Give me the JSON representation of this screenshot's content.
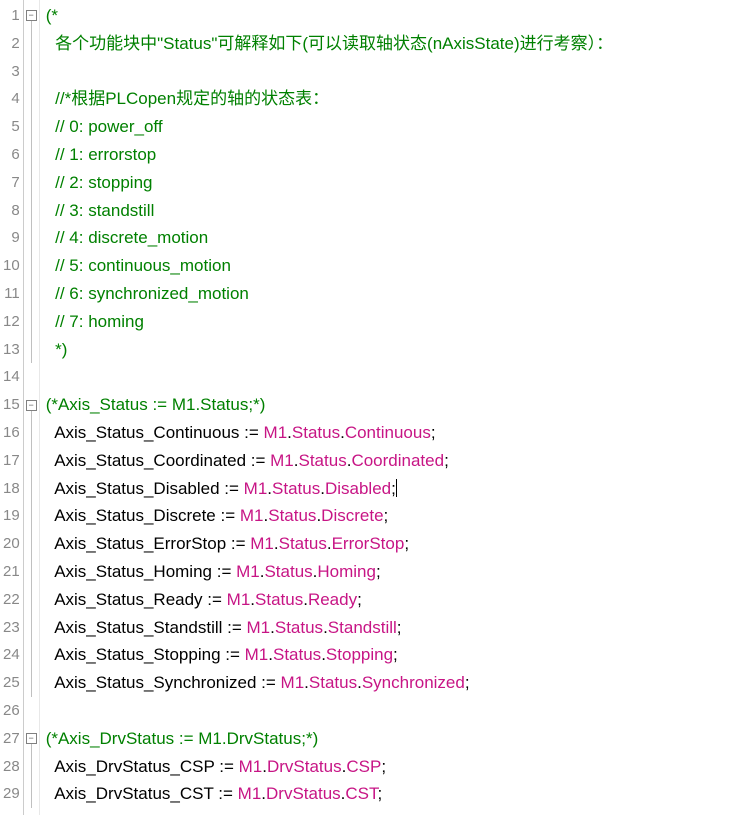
{
  "lines": [
    {
      "num": 1,
      "fold": "box",
      "spans": [
        {
          "cls": "c-comment",
          "t": "(*"
        }
      ]
    },
    {
      "num": 2,
      "fold": "line",
      "spans": [
        {
          "cls": "c-comment",
          "t": "  各个功能块中\"Status\"可解释如下(可以读取轴状态(nAxisState)进行考察）："
        }
      ]
    },
    {
      "num": 3,
      "fold": "line",
      "spans": [
        {
          "cls": "c-comment",
          "t": ""
        }
      ]
    },
    {
      "num": 4,
      "fold": "line",
      "spans": [
        {
          "cls": "c-comment",
          "t": "  //*根据PLCopen规定的轴的状态表："
        }
      ]
    },
    {
      "num": 5,
      "fold": "line",
      "spans": [
        {
          "cls": "c-comment",
          "t": "  // 0: power_off"
        }
      ]
    },
    {
      "num": 6,
      "fold": "line",
      "spans": [
        {
          "cls": "c-comment",
          "t": "  // 1: errorstop"
        }
      ]
    },
    {
      "num": 7,
      "fold": "line",
      "spans": [
        {
          "cls": "c-comment",
          "t": "  // 2: stopping"
        }
      ]
    },
    {
      "num": 8,
      "fold": "line",
      "spans": [
        {
          "cls": "c-comment",
          "t": "  // 3: standstill"
        }
      ]
    },
    {
      "num": 9,
      "fold": "line",
      "spans": [
        {
          "cls": "c-comment",
          "t": "  // 4: discrete_motion"
        }
      ]
    },
    {
      "num": 10,
      "fold": "line",
      "spans": [
        {
          "cls": "c-comment",
          "t": "  // 5: continuous_motion"
        }
      ]
    },
    {
      "num": 11,
      "fold": "line",
      "spans": [
        {
          "cls": "c-comment",
          "t": "  // 6: synchronized_motion"
        }
      ]
    },
    {
      "num": 12,
      "fold": "line",
      "spans": [
        {
          "cls": "c-comment",
          "t": "  // 7: homing"
        }
      ]
    },
    {
      "num": 13,
      "fold": "line",
      "spans": [
        {
          "cls": "c-comment",
          "t": "  *)"
        }
      ]
    },
    {
      "num": 14,
      "fold": "none",
      "spans": [
        {
          "cls": "",
          "t": ""
        }
      ]
    },
    {
      "num": 15,
      "fold": "box",
      "spans": [
        {
          "cls": "c-comment",
          "t": "(*Axis_Status := M1.Status;*)"
        }
      ]
    },
    {
      "num": 16,
      "fold": "line",
      "spans": [
        {
          "cls": "c-var",
          "t": "  Axis_Status_Continuous "
        },
        {
          "cls": "c-op",
          "t": ":= "
        },
        {
          "cls": "c-member",
          "t": "M1"
        },
        {
          "cls": "c-op",
          "t": "."
        },
        {
          "cls": "c-member",
          "t": "Status"
        },
        {
          "cls": "c-op",
          "t": "."
        },
        {
          "cls": "c-member",
          "t": "Continuous"
        },
        {
          "cls": "c-op",
          "t": ";"
        }
      ]
    },
    {
      "num": 17,
      "fold": "line",
      "spans": [
        {
          "cls": "c-var",
          "t": "  Axis_Status_Coordinated "
        },
        {
          "cls": "c-op",
          "t": ":= "
        },
        {
          "cls": "c-member",
          "t": "M1"
        },
        {
          "cls": "c-op",
          "t": "."
        },
        {
          "cls": "c-member",
          "t": "Status"
        },
        {
          "cls": "c-op",
          "t": "."
        },
        {
          "cls": "c-member",
          "t": "Coordinated"
        },
        {
          "cls": "c-op",
          "t": ";"
        }
      ]
    },
    {
      "num": 18,
      "fold": "line",
      "cursor": true,
      "spans": [
        {
          "cls": "c-var",
          "t": "  Axis_Status_Disabled "
        },
        {
          "cls": "c-op",
          "t": ":= "
        },
        {
          "cls": "c-member",
          "t": "M1"
        },
        {
          "cls": "c-op",
          "t": "."
        },
        {
          "cls": "c-member",
          "t": "Status"
        },
        {
          "cls": "c-op",
          "t": "."
        },
        {
          "cls": "c-member",
          "t": "Disabled"
        },
        {
          "cls": "c-op",
          "t": ";"
        }
      ]
    },
    {
      "num": 19,
      "fold": "line",
      "spans": [
        {
          "cls": "c-var",
          "t": "  Axis_Status_Discrete "
        },
        {
          "cls": "c-op",
          "t": ":= "
        },
        {
          "cls": "c-member",
          "t": "M1"
        },
        {
          "cls": "c-op",
          "t": "."
        },
        {
          "cls": "c-member",
          "t": "Status"
        },
        {
          "cls": "c-op",
          "t": "."
        },
        {
          "cls": "c-member",
          "t": "Discrete"
        },
        {
          "cls": "c-op",
          "t": ";"
        }
      ]
    },
    {
      "num": 20,
      "fold": "line",
      "spans": [
        {
          "cls": "c-var",
          "t": "  Axis_Status_ErrorStop "
        },
        {
          "cls": "c-op",
          "t": ":= "
        },
        {
          "cls": "c-member",
          "t": "M1"
        },
        {
          "cls": "c-op",
          "t": "."
        },
        {
          "cls": "c-member",
          "t": "Status"
        },
        {
          "cls": "c-op",
          "t": "."
        },
        {
          "cls": "c-member",
          "t": "ErrorStop"
        },
        {
          "cls": "c-op",
          "t": ";"
        }
      ]
    },
    {
      "num": 21,
      "fold": "line",
      "spans": [
        {
          "cls": "c-var",
          "t": "  Axis_Status_Homing "
        },
        {
          "cls": "c-op",
          "t": ":= "
        },
        {
          "cls": "c-member",
          "t": "M1"
        },
        {
          "cls": "c-op",
          "t": "."
        },
        {
          "cls": "c-member",
          "t": "Status"
        },
        {
          "cls": "c-op",
          "t": "."
        },
        {
          "cls": "c-member",
          "t": "Homing"
        },
        {
          "cls": "c-op",
          "t": ";"
        }
      ]
    },
    {
      "num": 22,
      "fold": "line",
      "spans": [
        {
          "cls": "c-var",
          "t": "  Axis_Status_Ready "
        },
        {
          "cls": "c-op",
          "t": ":= "
        },
        {
          "cls": "c-member",
          "t": "M1"
        },
        {
          "cls": "c-op",
          "t": "."
        },
        {
          "cls": "c-member",
          "t": "Status"
        },
        {
          "cls": "c-op",
          "t": "."
        },
        {
          "cls": "c-member",
          "t": "Ready"
        },
        {
          "cls": "c-op",
          "t": ";"
        }
      ]
    },
    {
      "num": 23,
      "fold": "line",
      "spans": [
        {
          "cls": "c-var",
          "t": "  Axis_Status_Standstill "
        },
        {
          "cls": "c-op",
          "t": ":= "
        },
        {
          "cls": "c-member",
          "t": "M1"
        },
        {
          "cls": "c-op",
          "t": "."
        },
        {
          "cls": "c-member",
          "t": "Status"
        },
        {
          "cls": "c-op",
          "t": "."
        },
        {
          "cls": "c-member",
          "t": "Standstill"
        },
        {
          "cls": "c-op",
          "t": ";"
        }
      ]
    },
    {
      "num": 24,
      "fold": "line",
      "spans": [
        {
          "cls": "c-var",
          "t": "  Axis_Status_Stopping "
        },
        {
          "cls": "c-op",
          "t": ":= "
        },
        {
          "cls": "c-member",
          "t": "M1"
        },
        {
          "cls": "c-op",
          "t": "."
        },
        {
          "cls": "c-member",
          "t": "Status"
        },
        {
          "cls": "c-op",
          "t": "."
        },
        {
          "cls": "c-member",
          "t": "Stopping"
        },
        {
          "cls": "c-op",
          "t": ";"
        }
      ]
    },
    {
      "num": 25,
      "fold": "line",
      "spans": [
        {
          "cls": "c-var",
          "t": "  Axis_Status_Synchronized "
        },
        {
          "cls": "c-op",
          "t": ":= "
        },
        {
          "cls": "c-member",
          "t": "M1"
        },
        {
          "cls": "c-op",
          "t": "."
        },
        {
          "cls": "c-member",
          "t": "Status"
        },
        {
          "cls": "c-op",
          "t": "."
        },
        {
          "cls": "c-member",
          "t": "Synchronized"
        },
        {
          "cls": "c-op",
          "t": ";"
        }
      ]
    },
    {
      "num": 26,
      "fold": "none",
      "spans": [
        {
          "cls": "",
          "t": ""
        }
      ]
    },
    {
      "num": 27,
      "fold": "box",
      "spans": [
        {
          "cls": "c-comment",
          "t": "(*Axis_DrvStatus := M1.DrvStatus;*)"
        }
      ]
    },
    {
      "num": 28,
      "fold": "line",
      "spans": [
        {
          "cls": "c-var",
          "t": "  Axis_DrvStatus_CSP "
        },
        {
          "cls": "c-op",
          "t": ":= "
        },
        {
          "cls": "c-member",
          "t": "M1"
        },
        {
          "cls": "c-op",
          "t": "."
        },
        {
          "cls": "c-member",
          "t": "DrvStatus"
        },
        {
          "cls": "c-op",
          "t": "."
        },
        {
          "cls": "c-member",
          "t": "CSP"
        },
        {
          "cls": "c-op",
          "t": ";"
        }
      ]
    },
    {
      "num": 29,
      "fold": "line",
      "spans": [
        {
          "cls": "c-var",
          "t": "  Axis_DrvStatus_CST "
        },
        {
          "cls": "c-op",
          "t": ":= "
        },
        {
          "cls": "c-member",
          "t": "M1"
        },
        {
          "cls": "c-op",
          "t": "."
        },
        {
          "cls": "c-member",
          "t": "DrvStatus"
        },
        {
          "cls": "c-op",
          "t": "."
        },
        {
          "cls": "c-member",
          "t": "CST"
        },
        {
          "cls": "c-op",
          "t": ";"
        }
      ]
    }
  ],
  "foldGlyph": "−"
}
